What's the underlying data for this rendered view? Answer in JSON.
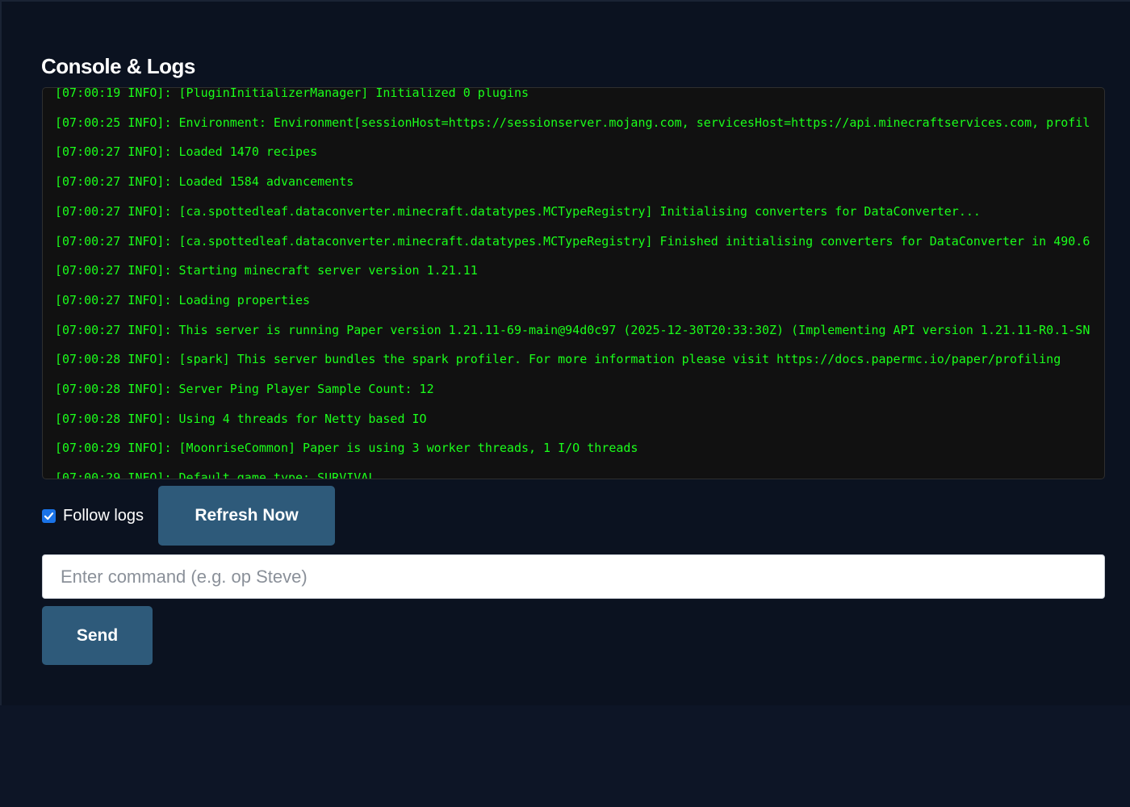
{
  "header": {
    "title": "Console & Logs"
  },
  "console": {
    "lines": [
      "[07:00:19 INFO]: [PluginInitializerManager] Initialized 0 plugins",
      "[07:00:25 INFO]: Environment: Environment[sessionHost=https://sessionserver.mojang.com, servicesHost=https://api.minecraftservices.com, profil",
      "[07:00:27 INFO]: Loaded 1470 recipes",
      "[07:00:27 INFO]: Loaded 1584 advancements",
      "[07:00:27 INFO]: [ca.spottedleaf.dataconverter.minecraft.datatypes.MCTypeRegistry] Initialising converters for DataConverter...",
      "[07:00:27 INFO]: [ca.spottedleaf.dataconverter.minecraft.datatypes.MCTypeRegistry] Finished initialising converters for DataConverter in 490.6",
      "[07:00:27 INFO]: Starting minecraft server version 1.21.11",
      "[07:00:27 INFO]: Loading properties",
      "[07:00:27 INFO]: This server is running Paper version 1.21.11-69-main@94d0c97 (2025-12-30T20:33:30Z) (Implementing API version 1.21.11-R0.1-SN",
      "[07:00:28 INFO]: [spark] This server bundles the spark profiler. For more information please visit https://docs.papermc.io/paper/profiling",
      "[07:00:28 INFO]: Server Ping Player Sample Count: 12",
      "[07:00:28 INFO]: Using 4 threads for Netty based IO",
      "[07:00:29 INFO]: [MoonriseCommon] Paper is using 3 worker threads, 1 I/O threads",
      "[07:00:29 INFO]: Default game type: SURVIVAL"
    ],
    "text_color": "#1bff1b",
    "background_color": "#111111"
  },
  "controls": {
    "follow_logs_label": "Follow logs",
    "follow_logs_checked": true,
    "refresh_label": "Refresh Now"
  },
  "command": {
    "placeholder": "Enter command (e.g. op Steve)",
    "value": "",
    "send_label": "Send"
  },
  "colors": {
    "page_background": "#0b1220",
    "button_background": "#2e5a7a",
    "checkbox_accent": "#1a73e8"
  }
}
